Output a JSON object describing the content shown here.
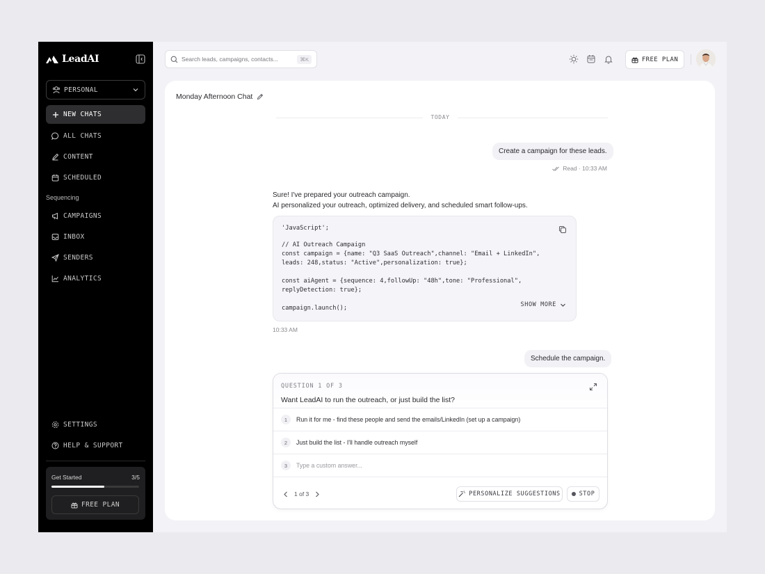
{
  "app": {
    "name": "LeadAI"
  },
  "sidebar": {
    "workspace": "PERSONAL",
    "new_chat": "NEW CHATS",
    "items": [
      {
        "label": "ALL CHATS",
        "icon": "chat-bubble-icon"
      },
      {
        "label": "CONTENT",
        "icon": "pencil-icon"
      },
      {
        "label": "SCHEDULED",
        "icon": "calendar-icon"
      }
    ],
    "section_label": "Sequencing",
    "sequencing_items": [
      {
        "label": "CAMPAIGNS",
        "icon": "megaphone-icon"
      },
      {
        "label": "INBOX",
        "icon": "inbox-icon"
      },
      {
        "label": "SENDERS",
        "icon": "send-icon"
      },
      {
        "label": "ANALYTICS",
        "icon": "chart-icon"
      }
    ],
    "bottom_items": [
      {
        "label": "SETTINGS",
        "icon": "gear-icon"
      },
      {
        "label": "HELP & SUPPORT",
        "icon": "help-icon"
      }
    ],
    "get_started": {
      "label": "Get Started",
      "count": "3/5",
      "progress": 0.6
    },
    "plan_button": "FREE PLAN"
  },
  "topbar": {
    "search_placeholder": "Search leads, campaigns, contacts...",
    "shortcut": "⌘K",
    "plan_button": "FREE PLAN"
  },
  "chat": {
    "title": "Monday Afternoon Chat",
    "day_label": "TODAY",
    "user_message_1": "Create a campaign for these leads.",
    "read_status": "Read · 10:33 AM",
    "assistant_line_1": "Sure! I've prepared your outreach campaign.",
    "assistant_line_2": "AI personalized your outreach, optimized delivery, and scheduled smart follow-ups.",
    "code_lines": [
      "'JavaScript';",
      "// AI Outreach Campaign",
      "const campaign = {name: \"Q3 SaaS Outreach\",channel: \"Email + LinkedIn\",",
      "leads: 248,status: \"Active\",personalization: true};",
      "const aiAgent = {sequence: 4,followUp: \"48h\",tone: \"Professional\",",
      "replyDetection: true};",
      "campaign.launch();"
    ],
    "show_more": "SHOW MORE",
    "assistant_time": "10:33 AM",
    "user_message_2": "Schedule the campaign."
  },
  "question": {
    "label": "QUESTION 1 OF 3",
    "title": "Want LeadAI to run the outreach, or just build the list?",
    "options": [
      {
        "num": "1",
        "text": "Run it for me - find these people and send the emails/LinkedIn (set up a campaign)"
      },
      {
        "num": "2",
        "text": "Just build the list - I'll handle outreach myself"
      },
      {
        "num": "3",
        "text": "Type a custom answer..."
      }
    ],
    "pager": "1 of 3",
    "personalize_button": "PERSONALIZE SUGGESTIONS",
    "stop_button": "STOP"
  }
}
